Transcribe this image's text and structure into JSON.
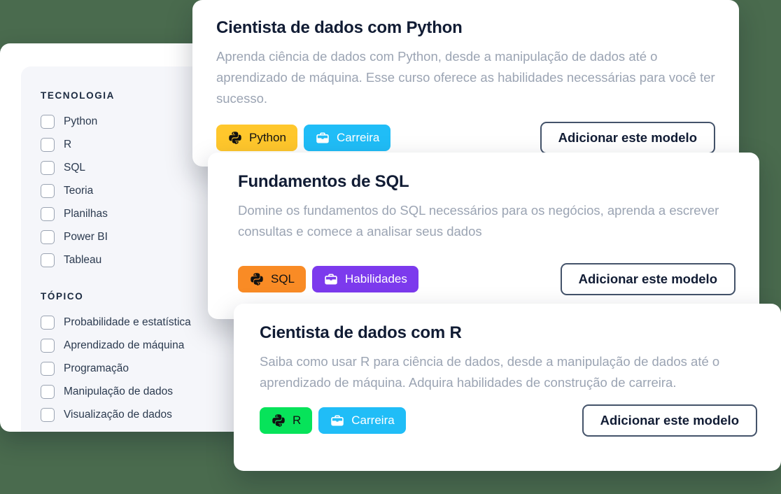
{
  "theme": {
    "background": "#4a6b4e",
    "card_background": "#ffffff",
    "panel_background": "#f5f6fa",
    "title_color": "#111c34",
    "description_color": "#9ba4b3",
    "button_border_color": "#44536a"
  },
  "sidebar": {
    "groups": [
      {
        "title": "TECNOLOGIA",
        "items": [
          {
            "label": "Python",
            "checked": false
          },
          {
            "label": "R",
            "checked": false
          },
          {
            "label": "SQL",
            "checked": false
          },
          {
            "label": "Teoria",
            "checked": false
          },
          {
            "label": "Planilhas",
            "checked": false
          },
          {
            "label": "Power BI",
            "checked": false
          },
          {
            "label": "Tableau",
            "checked": false
          }
        ]
      },
      {
        "title": "TÓPICO",
        "items": [
          {
            "label": "Probabilidade e estatística",
            "checked": false
          },
          {
            "label": "Aprendizado de máquina",
            "checked": false
          },
          {
            "label": "Programação",
            "checked": false
          },
          {
            "label": "Manipulação de dados",
            "checked": false
          },
          {
            "label": "Visualização de dados",
            "checked": false
          }
        ]
      }
    ]
  },
  "cards": [
    {
      "title": "Cientista de dados com Python",
      "description": "Aprenda ciência de dados com Python, desde a manipulação de dados até o aprendizado de máquina. Esse curso oferece as habilidades necessárias para você ter sucesso.",
      "tags": [
        {
          "label": "Python",
          "icon": "python-icon",
          "background": "#ffc72c",
          "text_color": "#111111"
        },
        {
          "label": "Carreira",
          "icon": "briefcase-icon",
          "background": "#20bdf7",
          "text_color": "#ffffff"
        }
      ],
      "button_label": "Adicionar este modelo"
    },
    {
      "title": "Fundamentos de SQL",
      "description": "Domine os fundamentos do SQL necessários para os negócios, aprenda a escrever consultas e comece a analisar seus dados",
      "tags": [
        {
          "label": "SQL",
          "icon": "python-icon",
          "background": "#f98b25",
          "text_color": "#111111"
        },
        {
          "label": "Habilidades",
          "icon": "briefcase-icon",
          "background": "#7c3aed",
          "text_color": "#ffffff"
        }
      ],
      "button_label": "Adicionar este modelo"
    },
    {
      "title": "Cientista de dados com R",
      "description": "Saiba como usar R para ciência de dados, desde a manipulação de dados até o aprendizado de máquina. Adquira habilidades de construção de carreira.",
      "tags": [
        {
          "label": "R",
          "icon": "python-icon",
          "background": "#07e35a",
          "text_color": "#111111"
        },
        {
          "label": "Carreira",
          "icon": "briefcase-icon",
          "background": "#20bdf7",
          "text_color": "#ffffff"
        }
      ],
      "button_label": "Adicionar este modelo"
    }
  ]
}
